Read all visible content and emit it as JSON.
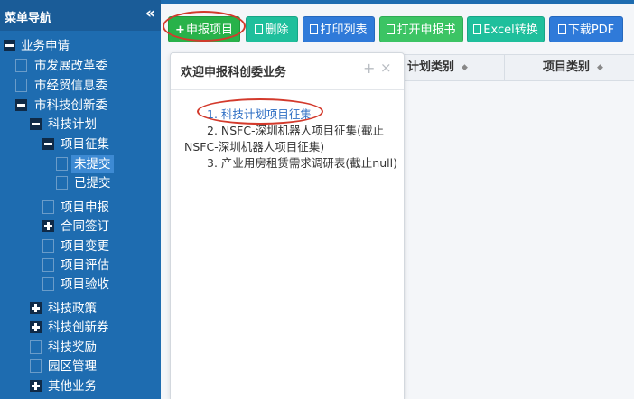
{
  "sidebar": {
    "title": "菜单导航",
    "collapse_icon": "«",
    "tree": {
      "root": "业务申请",
      "dev_reform": "市发展改革委",
      "econ_info": "市经贸信息委",
      "sci_tech": "市科技创新委",
      "sci_plan": "科技计划",
      "proj_collect": "项目征集",
      "not_submitted": "未提交",
      "submitted": "已提交",
      "proj_apply": "项目申报",
      "contract": "合同签订",
      "proj_change": "项目变更",
      "proj_eval": "项目评估",
      "proj_accept": "项目验收",
      "sci_policy": "科技政策",
      "innov_voucher": "科技创新券",
      "sci_award": "科技奖励",
      "park_mgmt": "园区管理",
      "other_biz": "其他业务"
    }
  },
  "toolbar": {
    "apply_label": "申报项目",
    "delete_label": "删除",
    "print_list_label": "打印列表",
    "open_apply_label": "打开申报书",
    "excel_label": "Excel转换",
    "pdf_label": "下载PDF"
  },
  "grid": {
    "col_plan_type": "计划类别",
    "col_proj_type": "项目类别",
    "sort_icon": "◆"
  },
  "popup": {
    "title": "欢迎申报科创委业务",
    "plus_icon": "+",
    "close_icon": "×",
    "items": {
      "item1": "1. 科技计划项目征集",
      "item2_line1": "2. NSFC-深圳机器人项目征集(截止",
      "item2_line2": "NSFC-深圳机器人项目征集)",
      "item3": "3. 产业用房租赁需求调研表(截止null)"
    }
  }
}
